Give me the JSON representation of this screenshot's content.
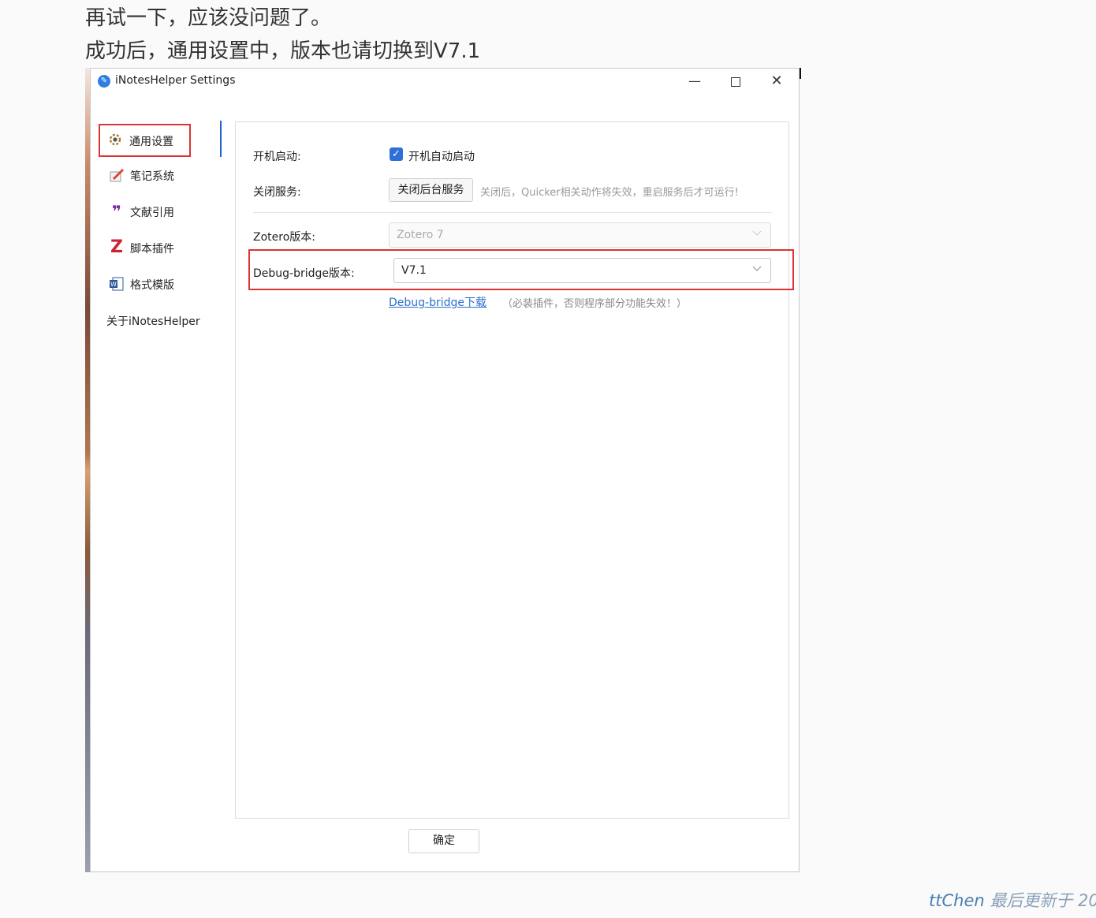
{
  "post": {
    "line1": "再试一下，应该没问题了。",
    "line2": "成功后，通用设置中，版本也请切换到V7.1"
  },
  "window": {
    "title": "iNotesHelper Settings",
    "app_icon": "pen-icon",
    "controls": {
      "minimize": "—",
      "close": "✕"
    }
  },
  "sidebar": {
    "items": [
      {
        "label": "通用设置",
        "icon": "gear-icon",
        "active": true
      },
      {
        "label": "笔记系统",
        "icon": "pencil-notebook-icon"
      },
      {
        "label": "文献引用",
        "icon": "quote-icon"
      },
      {
        "label": "脚本插件",
        "icon": "zotero-z-icon"
      },
      {
        "label": "格式模版",
        "icon": "word-doc-icon"
      },
      {
        "label": "关于iNotesHelper"
      }
    ]
  },
  "settings": {
    "autostart_label": "开机启动:",
    "autostart_checkbox_label": "开机自动启动",
    "autostart_checked": true,
    "service_label": "关闭服务:",
    "stop_service_button": "关闭后台服务",
    "service_hint": "关闭后，Quicker相关动作将失效，重启服务后才可运行!",
    "zotero_label": "Zotero版本:",
    "zotero_value": "Zotero 7",
    "debug_label": "Debug-bridge版本:",
    "debug_value": "V7.1",
    "debug_link": "Debug-bridge下载",
    "debug_note": "（必装插件，否则程序部分功能失效！）"
  },
  "ok_button": "确定",
  "footer": {
    "author": "ttChen",
    "updated": "最后更新于 20"
  },
  "colors": {
    "accent": "#2f6fd8",
    "highlight": "#dd3333",
    "link": "#2a6fd0"
  }
}
